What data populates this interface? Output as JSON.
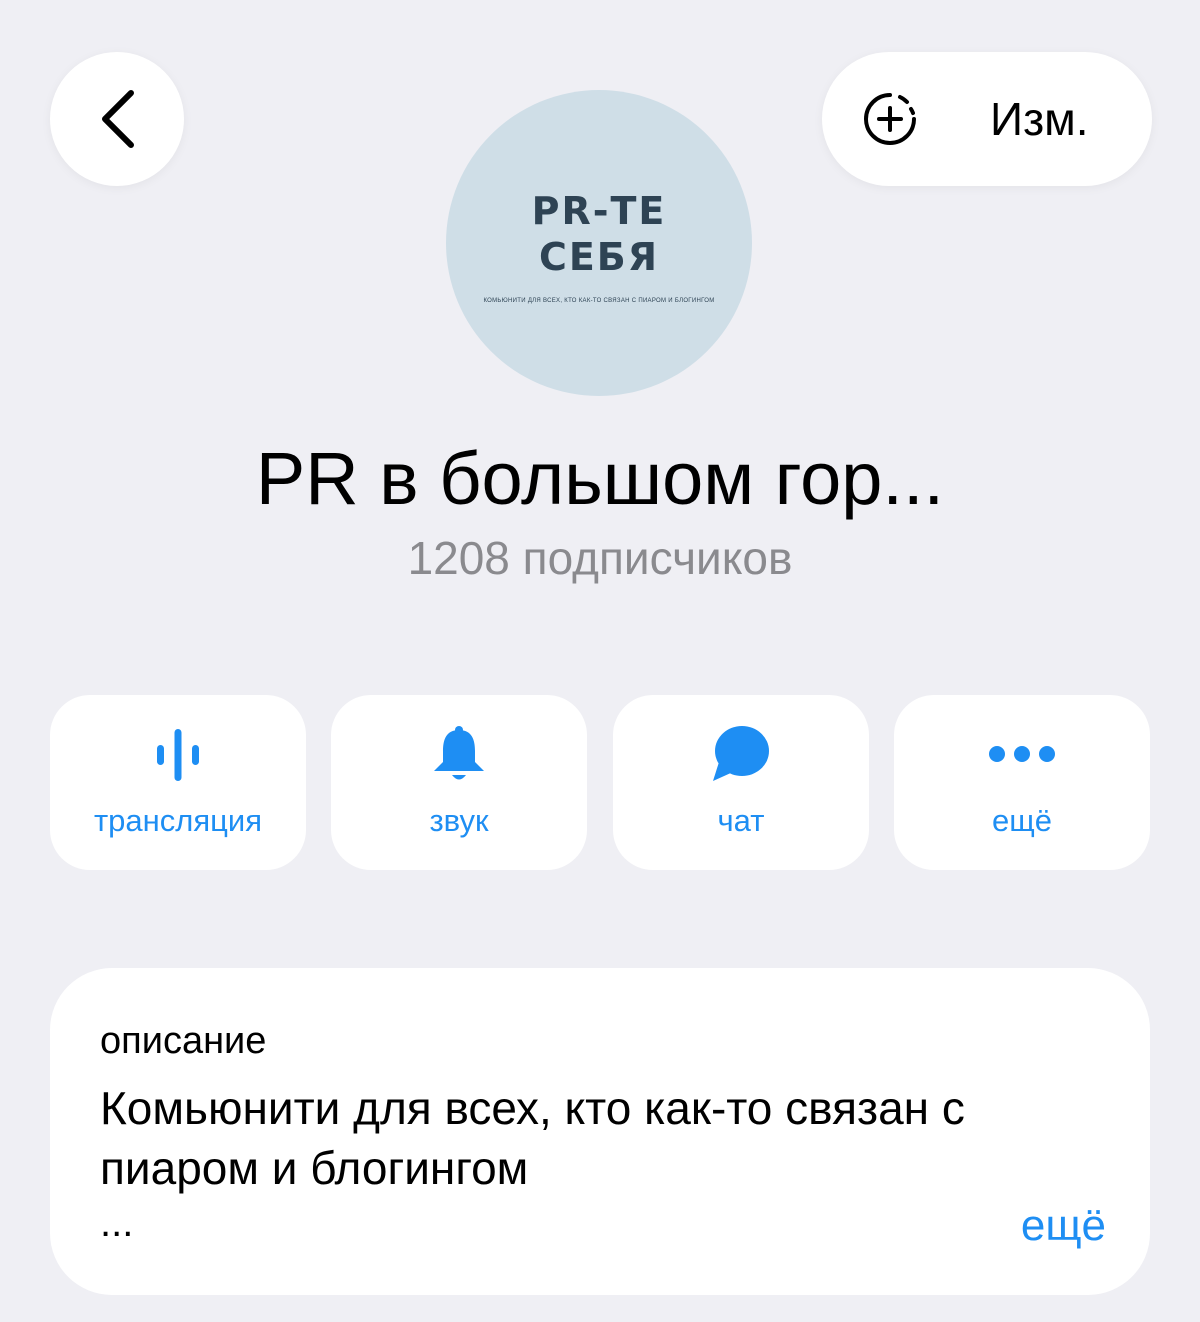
{
  "header": {
    "edit_label": "Изм.",
    "back_icon": "chevron-left-icon",
    "add_icon": "add-story-icon"
  },
  "avatar": {
    "title_line1": "PR-ТЕ",
    "title_line2": "СЕБЯ",
    "subtitle": "КОМЬЮНИТИ ДЛЯ ВСЕХ, КТО КАК-ТО СВЯЗАН С ПИАРОМ И БЛОГИНГОМ",
    "bg_color": "#cfdee7"
  },
  "channel": {
    "title": "PR в большом гор...",
    "subscribers": "1208 подписчиков"
  },
  "actions": [
    {
      "label": "трансляция",
      "icon": "live-stream-icon"
    },
    {
      "label": "звук",
      "icon": "bell-icon"
    },
    {
      "label": "чат",
      "icon": "chat-bubble-icon"
    },
    {
      "label": "ещё",
      "icon": "more-dots-icon"
    }
  ],
  "description": {
    "heading": "описание",
    "text": "Комьюнити для всех, кто как-то связан с пиаром и блогингом",
    "ellipsis": "...",
    "more_label": "ещё"
  },
  "colors": {
    "accent": "#1e8ef3",
    "background": "#efeff4",
    "secondary_text": "#8a8a8e"
  }
}
